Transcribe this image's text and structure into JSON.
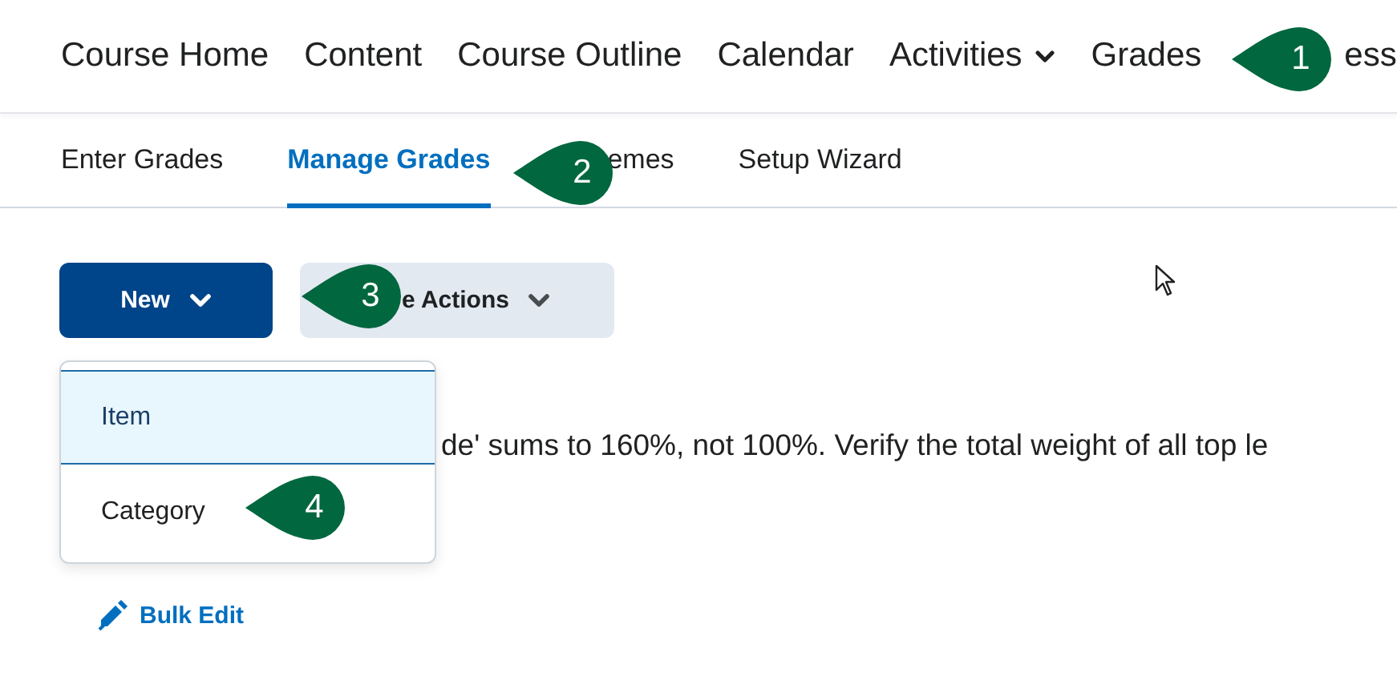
{
  "nav": {
    "items": [
      {
        "label": "Course Home",
        "dropdown": false
      },
      {
        "label": "Content",
        "dropdown": false
      },
      {
        "label": "Course Outline",
        "dropdown": false
      },
      {
        "label": "Calendar",
        "dropdown": false
      },
      {
        "label": "Activities",
        "dropdown": true
      },
      {
        "label": "Grades",
        "dropdown": false
      },
      {
        "label": "ess",
        "dropdown": false
      }
    ]
  },
  "tabs": [
    {
      "label": "Enter Grades",
      "selected": false
    },
    {
      "label": "Manage Grades",
      "selected": true
    },
    {
      "label": "emes",
      "selected": false
    },
    {
      "label": "Setup Wizard",
      "selected": false
    }
  ],
  "buttons": [
    {
      "label": "New",
      "kind": "primary"
    },
    {
      "label": "e Actions",
      "kind": "secondary"
    }
  ],
  "dropdown_menu": {
    "items": [
      {
        "label": "Item",
        "selected": true
      },
      {
        "label": "Category",
        "selected": false
      }
    ]
  },
  "message": "de' sums to 160%, not 100%. Verify the total weight of all top le",
  "bulk_edit": {
    "label": "Bulk Edit"
  },
  "callouts": [
    {
      "number": "1"
    },
    {
      "number": "2"
    },
    {
      "number": "3"
    },
    {
      "number": "4"
    }
  ]
}
